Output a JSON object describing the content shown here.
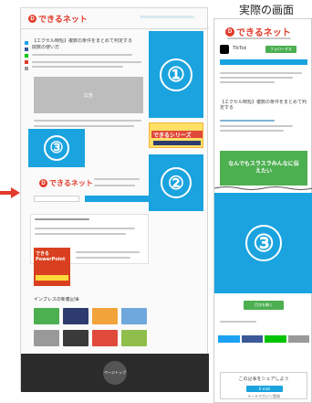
{
  "top_label": "実際の画面",
  "arrow": {
    "color": "#e23b2b"
  },
  "colors": {
    "accent_blue": "#1aa3df",
    "brand_red": "#e23b2b",
    "green": "#4caf50"
  },
  "desktop": {
    "site_logo": "できるネット",
    "article_title_line1": "【エクセル時短】複数の条件をまとめて判定する",
    "article_title_line2": "関数の使い方",
    "gray_ad_label": "広告",
    "block1_number": "①",
    "block2_number": "②",
    "block3_number": "③",
    "dekiru_series_badge": "できるシリーズ",
    "footer_logo": "できるネット",
    "pp_book_title": "できる PowerPoint",
    "related_heading": "インプレスの新着記事",
    "bottom_circle_label": "ページトップ"
  },
  "mobile": {
    "site_logo": "できるネット",
    "tiktok_label": "TikTok",
    "follow_button": "フォローする",
    "article_title": "【エクセル時短】複数の条件をまとめて判定する",
    "block3_number": "③",
    "green_banner": "なんでもスラスラみんなに伝えたい",
    "contents_button": "目次を開く",
    "share_text": "この記事をシェアしよう",
    "email_button": "E-mail",
    "small_footer": "メールマガジン登録"
  }
}
